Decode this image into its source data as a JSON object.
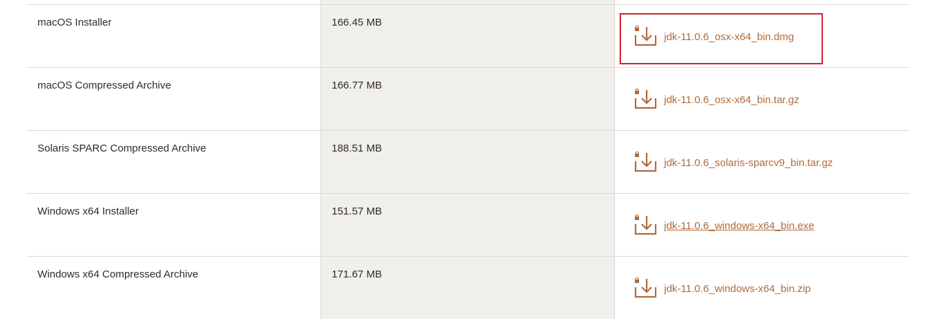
{
  "table": {
    "rows": [
      {
        "product": "macOS Installer",
        "size": "166.45 MB",
        "file": "jdk-11.0.6_osx-x64_bin.dmg",
        "icon": "download-icon"
      },
      {
        "product": "macOS Compressed Archive",
        "size": "166.77 MB",
        "file": "jdk-11.0.6_osx-x64_bin.tar.gz",
        "icon": "download-icon"
      },
      {
        "product": "Solaris SPARC Compressed Archive",
        "size": "188.51 MB",
        "file": "jdk-11.0.6_solaris-sparcv9_bin.tar.gz",
        "icon": "download-icon"
      },
      {
        "product": "Windows x64 Installer",
        "size": "151.57 MB",
        "file": "jdk-11.0.6_windows-x64_bin.exe",
        "icon": "download-icon"
      },
      {
        "product": "Windows x64 Compressed Archive",
        "size": "171.67 MB",
        "file": "jdk-11.0.6_windows-x64_bin.zip",
        "icon": "download-icon"
      }
    ]
  },
  "colors": {
    "link": "#b06a3b",
    "highlight": "#d0222f",
    "size_column_bg": "#f1efec"
  }
}
